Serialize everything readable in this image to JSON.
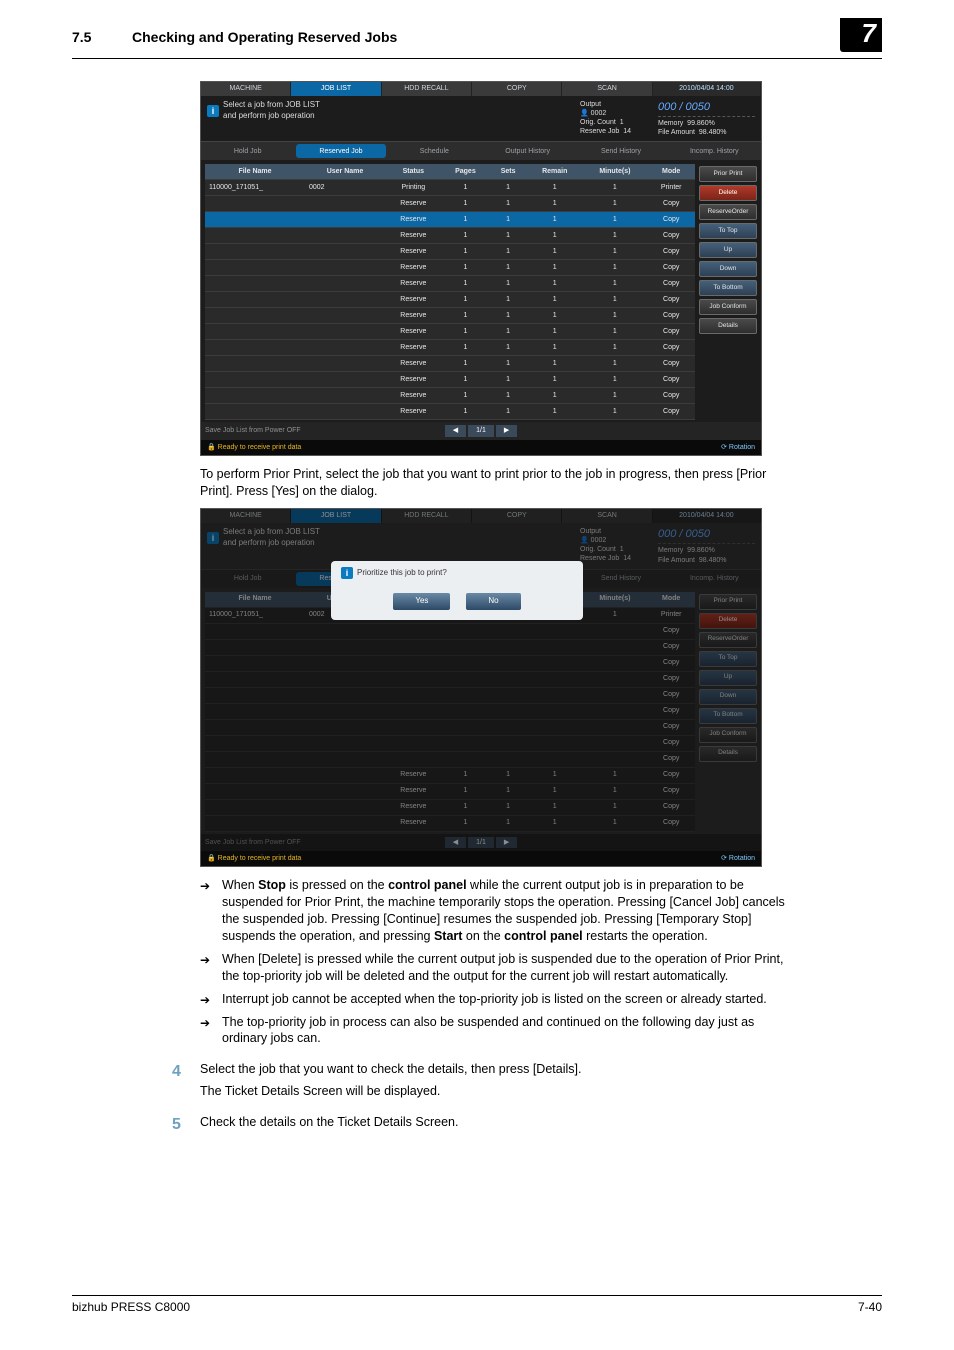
{
  "header": {
    "section_number": "7.5",
    "section_title": "Checking and Operating Reserved Jobs",
    "chapter": "7"
  },
  "chart_data": null,
  "content": {
    "caption1": "To perform Prior Print, select the job that you want to print prior to the job in progress, then press [Prior Print]. Press [Yes] on the dialog.",
    "bullets": [
      "When Stop is pressed on the control panel while the current output job is in preparation to be suspended for Prior Print, the machine temporarily stops the operation. Pressing [Cancel Job] cancels the suspended job. Pressing [Continue] resumes the suspended job. Pressing [Temporary Stop] suspends the operation, and pressing Start on the control panel restarts the operation.",
      "When [Delete] is pressed while the current output job is suspended due to the operation of Prior Print, the top-priority job will be deleted and the output for the current job will restart automatically.",
      "Interrupt job cannot be accepted when the top-priority job is listed on the screen or already started.",
      "The top-priority job in process can also be suspended and continued on the following day just as ordinary jobs can."
    ],
    "step4_num": "4",
    "step4_a": "Select the job that you want to check the details, then press [Details].",
    "step4_b": "The Ticket Details Screen will be displayed.",
    "step5_num": "5",
    "step5_a": "Check the details on the Ticket Details Screen."
  },
  "panel": {
    "tabs": [
      "MACHINE",
      "JOB LIST",
      "HDD RECALL",
      "COPY",
      "SCAN"
    ],
    "timestamp": "2010/04/04 14:00",
    "head_msg": "Select a job from JOB LIST\nand perform job operation",
    "output_label": "Output",
    "user": "0002",
    "count_val": "000 / 0050",
    "rows_a": [
      "Orig. Count",
      "Reserve Job"
    ],
    "rows_a_v": [
      "1",
      "14"
    ],
    "rows_b": [
      "Memory",
      "File Amount"
    ],
    "rows_b_v": [
      "99.860%",
      "98.480%"
    ],
    "sub_tabs": [
      "Hold Job",
      "Reserved Job",
      "Schedule",
      "Output History",
      "Send History",
      "Incomp. History"
    ],
    "columns": [
      "File Name",
      "User Name",
      "Status",
      "Pages",
      "Sets",
      "Remain",
      "Minute(s)",
      "Mode"
    ],
    "first_row": {
      "file": "110000_171051_",
      "user": "0002",
      "status": "Printing",
      "p": "1",
      "s": "1",
      "r": "1",
      "m": "1",
      "mode": "Printer"
    },
    "status_reserve": "Reserve",
    "mode_copy": "Copy",
    "side_buttons": [
      "Prior Print",
      "Delete",
      "ReserveOrder",
      "To Top",
      "Up",
      "Down",
      "To Bottom",
      "Job Conform",
      "Details"
    ],
    "foot_label": "  Save Job List from Power OFF",
    "pager_prev": "◀",
    "pager_page": "1/1",
    "pager_next": "▶",
    "status_ready": "Ready to receive print data",
    "status_rot": "Rotation"
  },
  "dialog": {
    "question": "Prioritize this job to print?",
    "yes": "Yes",
    "no": "No"
  },
  "footer": {
    "product": "bizhub PRESS C8000",
    "page": "7-40"
  }
}
